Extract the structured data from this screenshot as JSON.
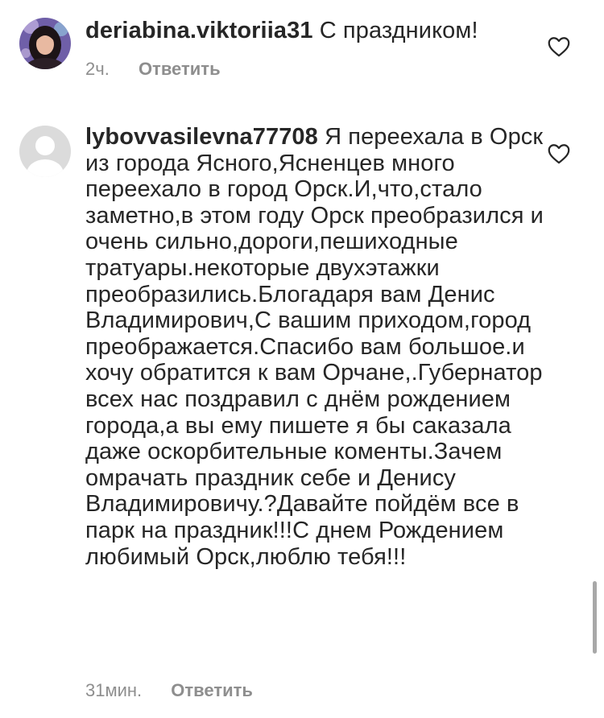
{
  "comments": [
    {
      "username": "deriabina.viktoriia31",
      "text": "С праздником!",
      "time": "2ч.",
      "reply_label": "Ответить",
      "avatar": "user-photo",
      "like_icon": "heart-outline-icon"
    },
    {
      "username": "lybovvasilevna77708",
      "text": "Я переехала в Орск из города Ясного,Ясненцев много переехало  в город Орск.И,что,стало заметно,в этом году Орск преобразился и очень сильно,дороги,пешиходные тратуары.некоторые двухэтажки преобразились.Блогадаря вам Денис Владимирович,С вашим приходом,город преображается.Спасибо вам большое.и хочу обратится к вам Орчане,.Губернатор всех нас поздравил с днём рождением города,а вы ему пишете я бы саказала даже оскорбительные коменты.Зачем омрачать праздник себе и Денису Владимировичу.?Давайте пойдём все в парк на праздник!!!С днем Рождением любимый Орск,люблю тебя!!!",
      "time": "31мин.",
      "reply_label": "Ответить",
      "avatar": "default-avatar",
      "like_icon": "heart-outline-icon"
    }
  ],
  "colors": {
    "text": "#262626",
    "secondary": "#8e8e8e",
    "default_avatar_bg": "#dbdbdb"
  }
}
